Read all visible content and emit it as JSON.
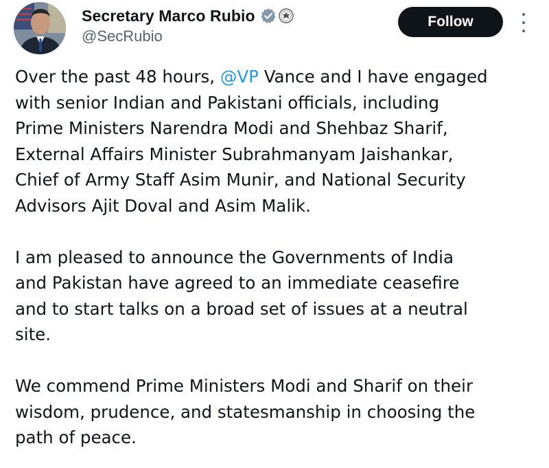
{
  "author": {
    "display_name": "Secretary Marco Rubio",
    "handle": "@SecRubio",
    "verified_icon": "verified-badge-icon",
    "affiliation_icon": "state-department-seal-icon",
    "verified_color": "#829aab"
  },
  "actions": {
    "follow_label": "Follow",
    "more_icon": "more-vertical-icon"
  },
  "mention": {
    "text": "@VP",
    "color": "#1d9bf0"
  },
  "tweet": {
    "p1": {
      "l1_before": "Over the past 48 hours, ",
      "l1_after": " Vance and I have engaged",
      "l2": "with senior Indian and Pakistani officials, including",
      "l3": "Prime Ministers Narendra Modi and Shehbaz Sharif,",
      "l4": "External Affairs Minister Subrahmanyam Jaishankar,",
      "l5": "Chief of Army Staff Asim Munir, and National Security",
      "l6": "Advisors Ajit Doval and Asim Malik."
    },
    "p2": {
      "l1": "I am pleased to announce the Governments of India",
      "l2": "and Pakistan have agreed to an immediate ceasefire",
      "l3": "and to start talks on a broad set of issues at a neutral",
      "l4": "site."
    },
    "p3": {
      "l1": "We commend Prime Ministers Modi and Sharif on their",
      "l2": "wisdom, prudence, and statesmanship in choosing the",
      "l3": "path of peace."
    }
  }
}
